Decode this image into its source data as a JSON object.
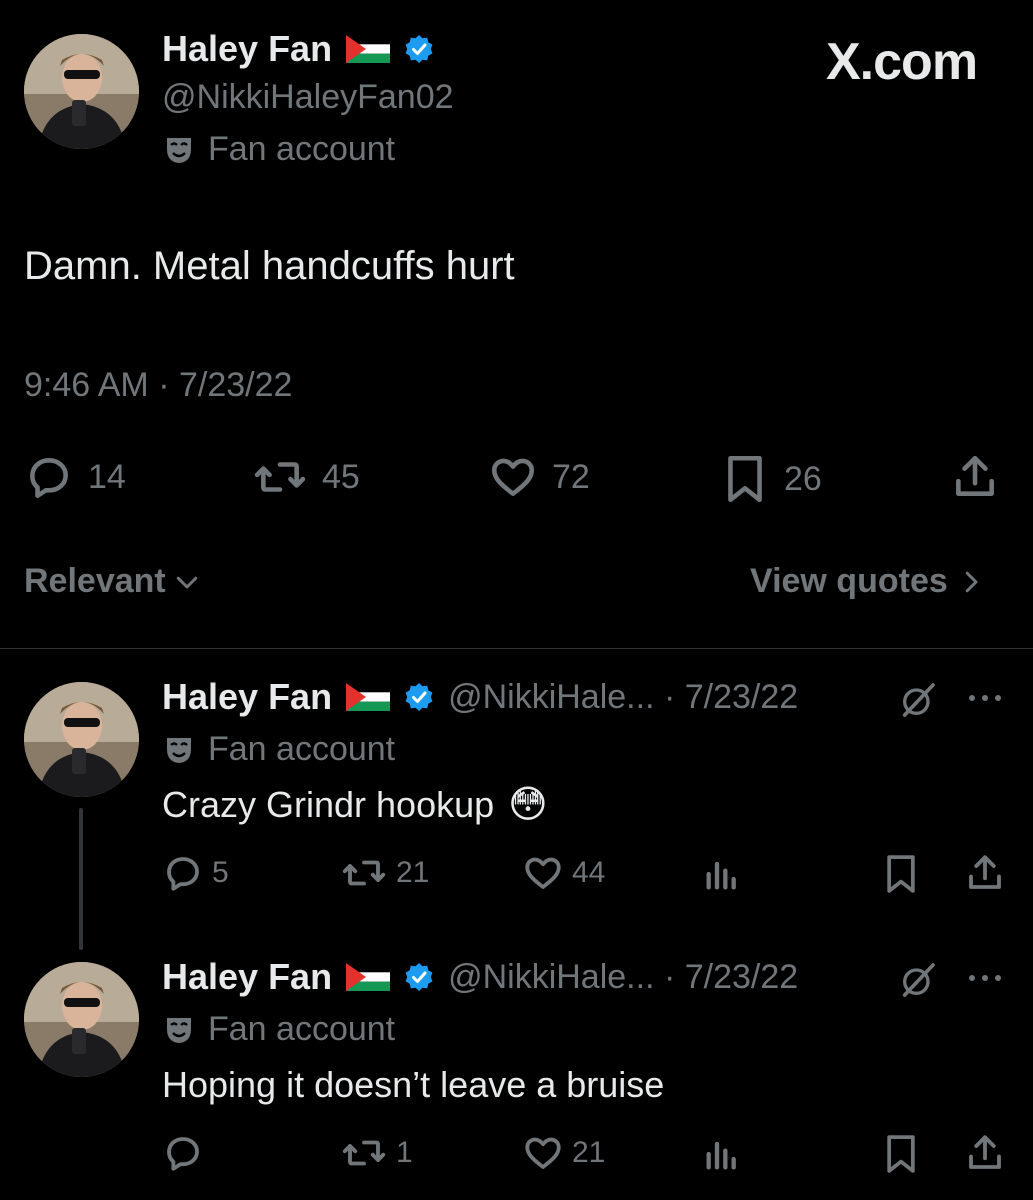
{
  "header": {
    "display_name": "Haley Fan",
    "handle": "@NikkiHaleyFan02",
    "account_label": "Fan account",
    "site_mark": "X.com",
    "icons": [
      "palestine-flag-icon",
      "verified-badge-icon",
      "theater-mask-icon"
    ]
  },
  "main_post": {
    "text": "Damn. Metal handcuffs hurt",
    "timestamp": "9:46 AM · 7/23/22",
    "replies": "14",
    "reposts": "45",
    "likes": "72",
    "bookmarks": "26"
  },
  "controls": {
    "sort_label": "Relevant",
    "view_quotes_label": "View quotes"
  },
  "replies": [
    {
      "display_name": "Haley Fan",
      "handle_date": "@NikkiHale... · 7/23/22",
      "account_label": "Fan account",
      "text": "Crazy Grindr hookup",
      "emoji": "😳",
      "replies": "5",
      "reposts": "21",
      "likes": "44"
    },
    {
      "display_name": "Haley Fan",
      "handle_date": "@NikkiHale... · 7/23/22",
      "account_label": "Fan account",
      "text": "Hoping it doesn’t leave a bruise",
      "emoji": "",
      "replies": "",
      "reposts": "1",
      "likes": "21"
    }
  ],
  "colors": {
    "background": "#000000",
    "text": "#e7e9ea",
    "secondary": "#71767b",
    "verified": "#1d9bf0",
    "divider": "#2f3336"
  }
}
